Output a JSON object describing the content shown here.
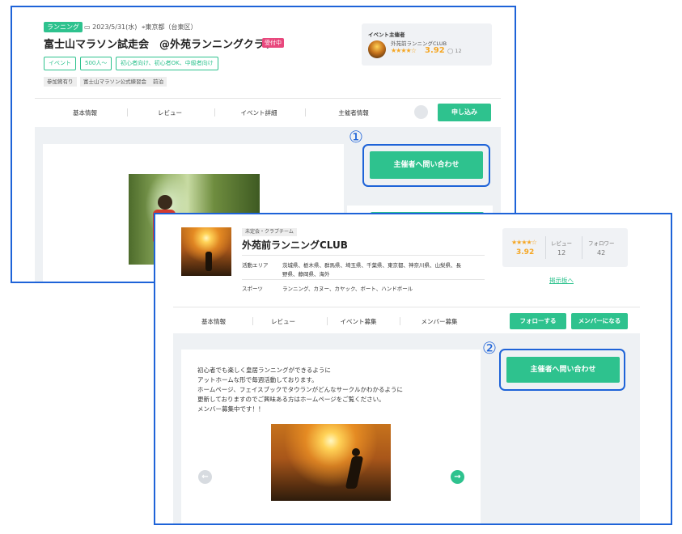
{
  "event_page": {
    "category_tag": "ランニング",
    "date": "2023/5/31(水)",
    "location": "東京都（台東区）",
    "title": "富士山マラソン試走会　@外苑ランニングクラブ",
    "status_badge": "受付中",
    "chips": [
      "イベント",
      "500人〜",
      "初心者向け、初心者OK、中級者向け"
    ],
    "gray_chips": [
      "参加賞有り",
      "富士山マラソン公式練習会",
      "前泊"
    ],
    "organizer_card": {
      "heading": "イベント主催者",
      "name": "外苑前ランニングCLUB",
      "stars": "★★★★☆",
      "rating": "3.92",
      "comment_count": "12"
    },
    "tabs": [
      "基本情報",
      "レビュー",
      "イベント詳細",
      "主催者情報"
    ],
    "apply_button": "申し込み",
    "contact_button": "主催者へ問い合わせ",
    "marker": "①"
  },
  "club_page": {
    "club_tag": "未定会・クラブチーム",
    "club_name": "外苑前ランニングCLUB",
    "area_label": "活動エリア",
    "area_value_line1": "茨城県、栃木県、群馬県、埼玉県、千葉県、東京都、神奈川県、山梨県、長",
    "area_value_line2": "野県、静岡県、海外",
    "sports_label": "スポーツ",
    "sports_value": "ランニング、カヌー、カヤック、ボート、ハンドボール",
    "stats": {
      "stars": "★★★★☆",
      "rating": "3.92",
      "review_label": "レビュー",
      "review_count": "12",
      "follower_label": "フォロワー",
      "follower_count": "42"
    },
    "board_link": "掲示板へ",
    "tabs": [
      "基本情報",
      "レビュー",
      "イベント募集",
      "メンバー募集"
    ],
    "follow_button": "フォローする",
    "member_button": "メンバーになる",
    "contact_button": "主催者へ問い合わせ",
    "marker": "②",
    "description": [
      "初心者でも楽しく皇居ランニングができるように",
      "アットホームな形で毎週活動しております。",
      "ホームページ、フェイスブックでタウランがどんなサークルかわかるように",
      "更新しておりますのでご興味ある方はホームページをご覧ください。",
      "メンバー募集中です！！"
    ],
    "prev_arrow": "←",
    "next_arrow": "→"
  },
  "colors": {
    "accent_green": "#2ec28e",
    "highlight_blue": "#1e63d8",
    "status_pink": "#e8487d",
    "star_orange": "#f5a623"
  }
}
